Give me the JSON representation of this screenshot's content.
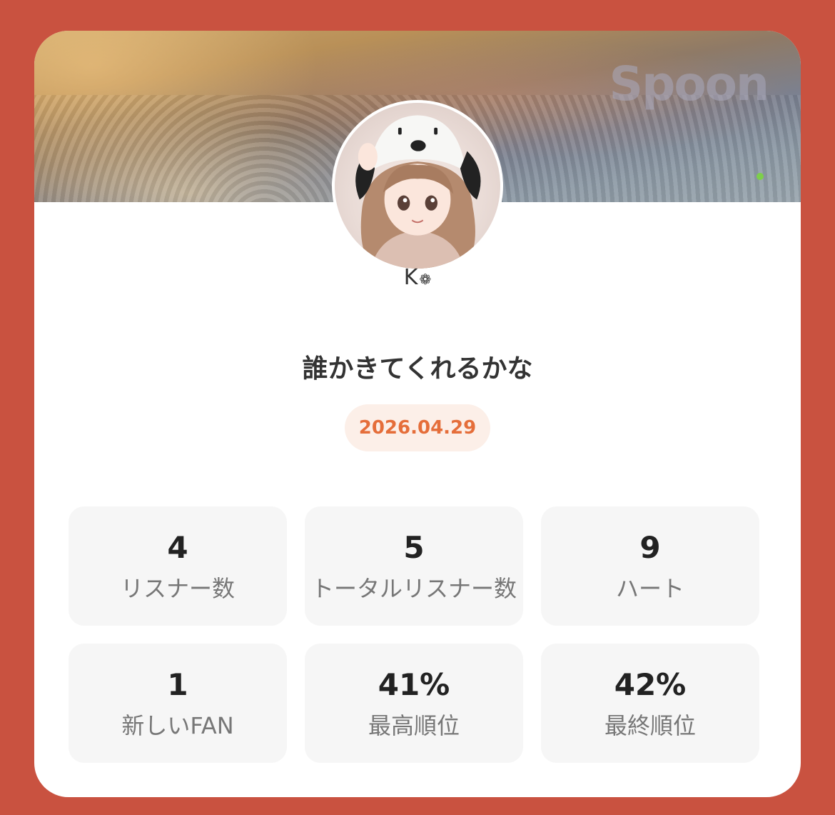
{
  "banner": {
    "watermark": "Spoon"
  },
  "profile": {
    "name": "K",
    "name_mark": "❁"
  },
  "live": {
    "title": "誰かきてくれるかな",
    "date": "2026.04.29"
  },
  "stats": [
    {
      "value": "4",
      "label": "リスナー数"
    },
    {
      "value": "5",
      "label": "トータルリスナー数"
    },
    {
      "value": "9",
      "label": "ハート"
    },
    {
      "value": "1",
      "label": "新しいFAN"
    },
    {
      "value": "41%",
      "label": "最高順位"
    },
    {
      "value": "42%",
      "label": "最終順位"
    }
  ],
  "colors": {
    "background": "#c95240",
    "accent": "#e56e3a",
    "accent_bg": "#fcefe8",
    "tile_bg": "#f6f6f6"
  }
}
